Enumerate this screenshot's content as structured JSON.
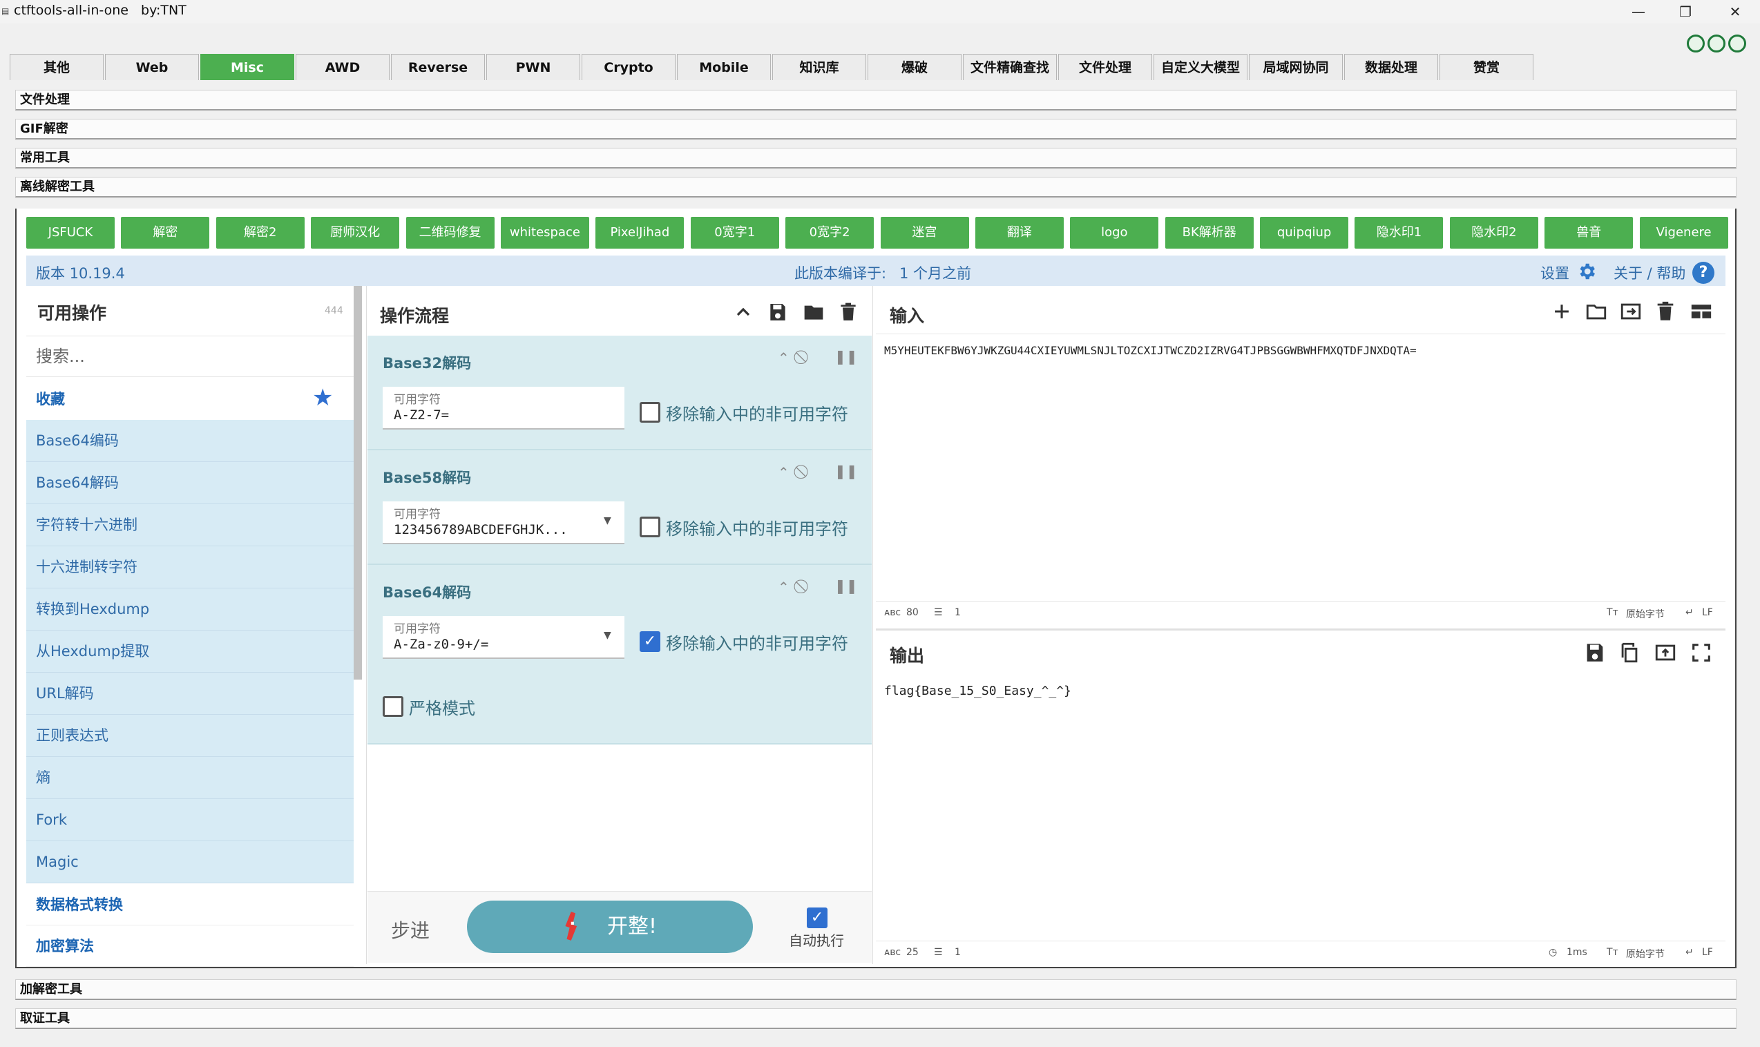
{
  "window": {
    "title": "ctftools-all-in-one   by:TNT",
    "minimize": "—",
    "maximize": "❐",
    "close": "✕"
  },
  "tabs": [
    "其他",
    "Web",
    "Misc",
    "AWD",
    "Reverse",
    "PWN",
    "Crypto",
    "Mobile",
    "知识库",
    "爆破",
    "文件精确查找",
    "文件处理",
    "自定义大模型",
    "局域网协同",
    "数据处理",
    "赞赏"
  ],
  "active_tab": "Misc",
  "sections_top": [
    "文件处理",
    "GIF解密",
    "常用工具",
    "离线解密工具"
  ],
  "sections_bottom": [
    "加解密工具",
    "取证工具"
  ],
  "tool_buttons": [
    "JSFUCK",
    "解密",
    "解密2",
    "厨师汉化",
    "二维码修复",
    "whitespace",
    "PixelJihad",
    "0宽字1",
    "0宽字2",
    "迷宫",
    "翻译",
    "logo",
    "BK解析器",
    "quipqiup",
    "隐水印1",
    "隐水印2",
    "兽音",
    "Vigenere"
  ],
  "cyberchef": {
    "version": "版本 10.19.4",
    "compiled_label": "此版本编译于:",
    "compiled_value": "1 个月之前",
    "settings": "设置",
    "about": "关于 / 帮助",
    "operations": {
      "title": "可用操作",
      "count": "444",
      "search_placeholder": "搜索...",
      "favourites": "收藏",
      "items": [
        "Base64编码",
        "Base64解码",
        "字符转十六进制",
        "十六进制转字符",
        "转换到Hexdump",
        "从Hexdump提取",
        "URL解码",
        "正则表达式",
        "熵",
        "Fork",
        "Magic"
      ],
      "categories": [
        "数据格式转换",
        "加密算法"
      ]
    },
    "recipe": {
      "title": "操作流程",
      "ops": [
        {
          "name": "Base32解码",
          "field_label": "可用字符",
          "field_value": "A-Z2-7=",
          "checkbox_label": "移除输入中的非可用字符",
          "checked": false
        },
        {
          "name": "Base58解码",
          "field_label": "可用字符",
          "field_value": "123456789ABCDEFGHJK...",
          "checkbox_label": "移除输入中的非可用字符",
          "checked": false
        },
        {
          "name": "Base64解码",
          "field_label": "可用字符",
          "field_value": "A-Za-z0-9+/=",
          "checkbox_label": "移除输入中的非可用字符",
          "checked": true
        }
      ],
      "strict_label": "严格模式",
      "step": "步进",
      "bake": "开整!",
      "auto_bake": "自动执行"
    },
    "input": {
      "title": "输入",
      "text": "M5YHEUTEKFBW6YJWKZGU44CXIEYUWMLSNJLTOZCXIJTWCZD2IZRVG4TJPBSGGWBWHFMXQTDFJNXDQTA=",
      "chars": "80",
      "lines": "1",
      "encoding": "原始字节",
      "eol": "LF"
    },
    "output": {
      "title": "输出",
      "text": "flag{Base_15_S0_Easy_^_^}",
      "chars": "25",
      "lines": "1",
      "time": "1ms",
      "encoding": "原始字节",
      "eol": "LF"
    }
  },
  "colors": {
    "accent_green": "#4caf50",
    "cyberchef_blue": "#2f6aa7",
    "recipe_bg": "#d9ecf0",
    "bake": "#5fa9b8"
  }
}
